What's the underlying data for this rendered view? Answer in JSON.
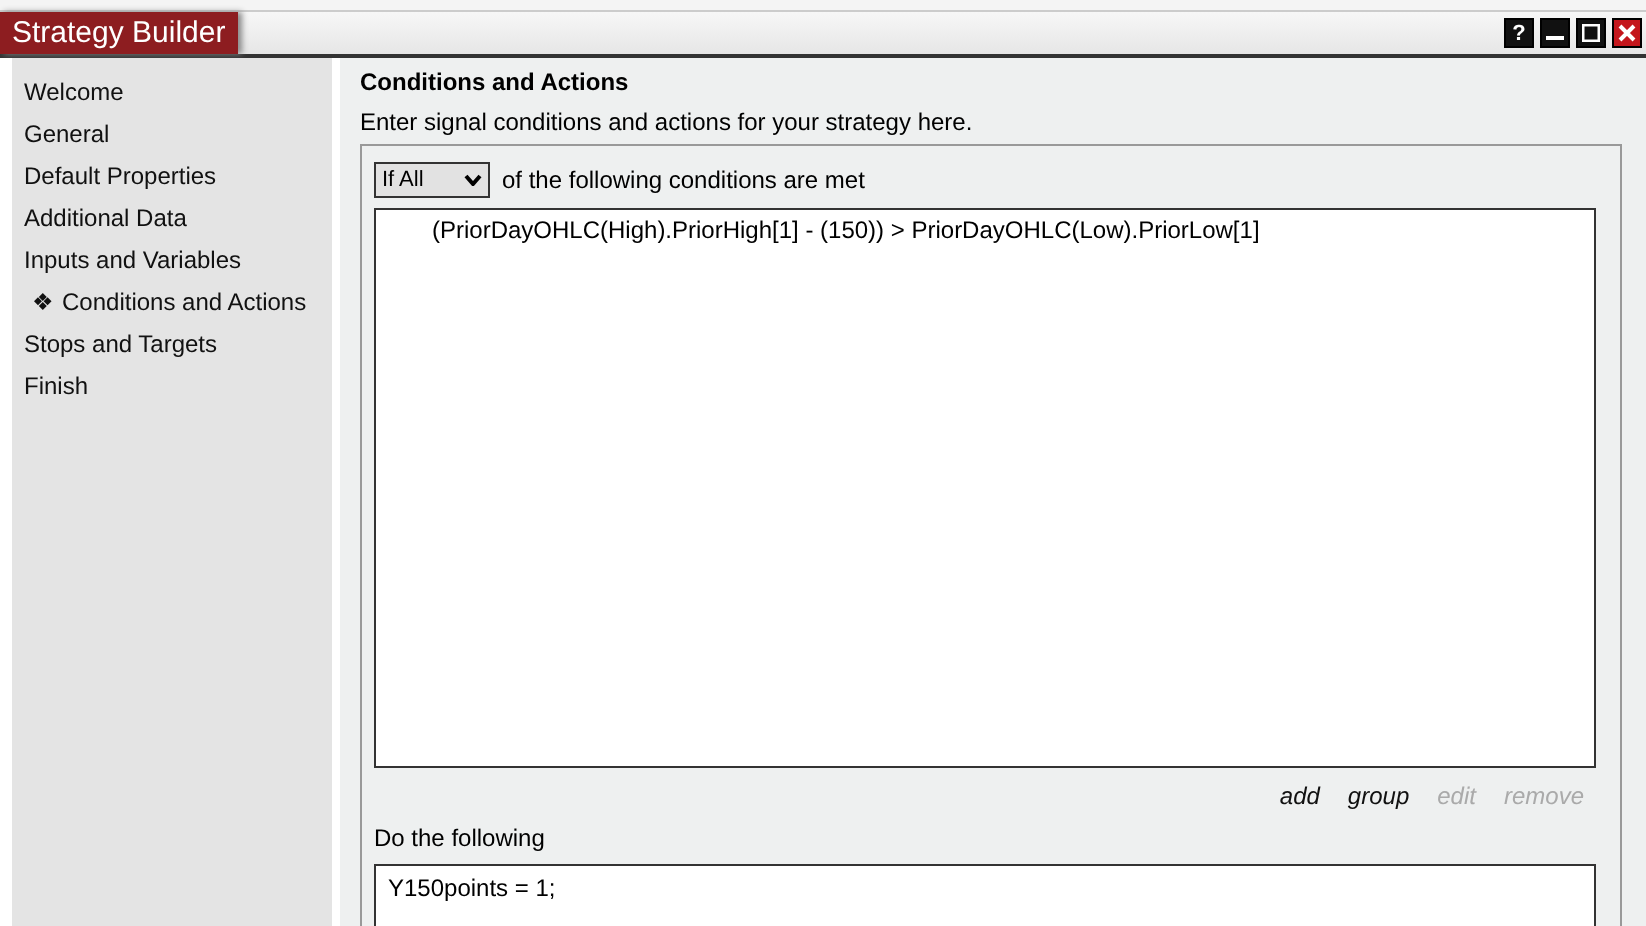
{
  "window": {
    "title": "Strategy Builder",
    "buttons": [
      {
        "kind": "help",
        "label": "?"
      },
      {
        "kind": "minimize"
      },
      {
        "kind": "maximize"
      },
      {
        "kind": "close"
      }
    ]
  },
  "sidebar": {
    "selected_marker": "❖",
    "items": [
      {
        "label": "Welcome",
        "selected": false
      },
      {
        "label": "General",
        "selected": false
      },
      {
        "label": "Default Properties",
        "selected": false
      },
      {
        "label": "Additional Data",
        "selected": false
      },
      {
        "label": "Inputs and Variables",
        "selected": false
      },
      {
        "label": "Conditions and Actions",
        "selected": true
      },
      {
        "label": "Stops and Targets",
        "selected": false
      },
      {
        "label": "Finish",
        "selected": false
      }
    ]
  },
  "content": {
    "heading": "Conditions and Actions",
    "description": "Enter signal conditions and actions for your strategy here.",
    "match_select": {
      "value": "If All"
    },
    "match_text": "of the following conditions are met",
    "conditions": [
      "(PriorDayOHLC(High).PriorHigh[1] - (150))  > PriorDayOHLC(Low).PriorLow[1]"
    ],
    "condition_actions": [
      {
        "label": "add",
        "disabled": false
      },
      {
        "label": "group",
        "disabled": false
      },
      {
        "label": "edit",
        "disabled": true
      },
      {
        "label": "remove",
        "disabled": true
      }
    ],
    "actions_label": "Do the following",
    "actions": [
      "Y150points = 1;"
    ]
  }
}
